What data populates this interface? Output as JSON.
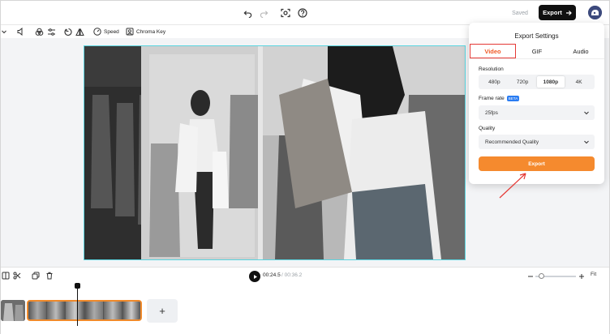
{
  "topbar": {
    "saved_label": "Saved",
    "export_label": "Export",
    "icons": [
      "undo-icon",
      "redo-icon",
      "screen-capture-icon",
      "help-icon"
    ]
  },
  "toolbar": {
    "speed_label": "Speed",
    "chroma_key_label": "Chroma Key"
  },
  "timeline": {
    "current_time": "00:24.5",
    "total_time": "/ 00:36.2",
    "fit_label": "Fit",
    "add_label": "+"
  },
  "export_settings": {
    "title": "Export Settings",
    "tabs": [
      {
        "label": "Video",
        "active": true
      },
      {
        "label": "GIF",
        "active": false
      },
      {
        "label": "Audio",
        "active": false
      }
    ],
    "resolution_label": "Resolution",
    "resolution_options": [
      "480p",
      "720p",
      "1080p",
      "4K"
    ],
    "resolution_selected": "1080p",
    "frame_rate_label": "Frame rate",
    "beta_badge": "BETA",
    "frame_rate_value": "25fps",
    "quality_label": "Quality",
    "quality_value": "Recommended Quality",
    "export_button": "Export"
  },
  "colors": {
    "accent_orange": "#f58a2e",
    "highlight_red": "#e53935",
    "canvas_border": "#5ad5e0"
  }
}
